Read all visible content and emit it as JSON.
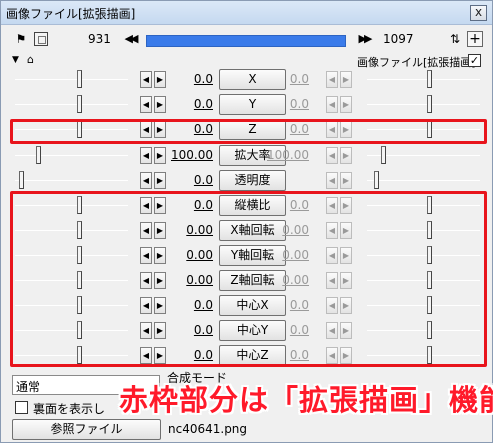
{
  "window": {
    "title": "画像ファイル[拡張描画]",
    "close": "x"
  },
  "frame": {
    "start": "931",
    "end": "1097",
    "prev_icon": "double-left-arrow-icon",
    "next_icon": "double-right-arrow-icon"
  },
  "object": {
    "label": "画像ファイル[拡張描画]",
    "checked": "✓"
  },
  "params": [
    {
      "label": "X",
      "value": "0.0",
      "end_value": "0.0"
    },
    {
      "label": "Y",
      "value": "0.0",
      "end_value": "0.0"
    },
    {
      "label": "Z",
      "value": "0.0",
      "end_value": "0.0"
    },
    {
      "label": "拡大率",
      "value": "100.00",
      "end_value": "100.00"
    },
    {
      "label": "透明度",
      "value": "0.0",
      "end_value": ""
    },
    {
      "label": "縦横比",
      "value": "0.0",
      "end_value": "0.0"
    },
    {
      "label": "X軸回転",
      "value": "0.00",
      "end_value": "0.00"
    },
    {
      "label": "Y軸回転",
      "value": "0.00",
      "end_value": "0.00"
    },
    {
      "label": "Z軸回転",
      "value": "0.00",
      "end_value": "0.00"
    },
    {
      "label": "中心X",
      "value": "0.0",
      "end_value": "0.0"
    },
    {
      "label": "中心Y",
      "value": "0.0",
      "end_value": "0.0"
    },
    {
      "label": "中心Z",
      "value": "0.0",
      "end_value": "0.0"
    }
  ],
  "blend": {
    "value": "通常",
    "label": "合成モード"
  },
  "reverse_checkbox": {
    "label": "裏面を表示し"
  },
  "reference": {
    "button": "参照ファイル",
    "file": "nc40641.png"
  },
  "annotation": {
    "text": "赤枠部分は「拡張描画」機能",
    "color": "#ff1a2a"
  },
  "colors": {
    "highlight": "#e8141c",
    "timeline": "#3a7bea"
  }
}
